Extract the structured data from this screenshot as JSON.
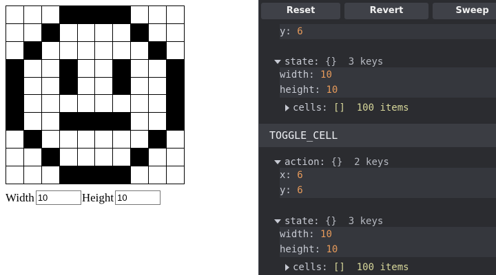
{
  "grid": {
    "cells": [
      0,
      0,
      0,
      1,
      1,
      1,
      1,
      0,
      0,
      0,
      0,
      0,
      1,
      0,
      0,
      0,
      0,
      1,
      0,
      0,
      0,
      1,
      0,
      0,
      0,
      0,
      0,
      0,
      1,
      0,
      1,
      0,
      0,
      1,
      0,
      0,
      1,
      0,
      0,
      1,
      1,
      0,
      0,
      1,
      0,
      0,
      1,
      0,
      0,
      1,
      1,
      0,
      0,
      0,
      0,
      0,
      0,
      0,
      0,
      1,
      1,
      0,
      0,
      1,
      1,
      1,
      1,
      0,
      0,
      1,
      0,
      1,
      0,
      0,
      0,
      0,
      0,
      0,
      1,
      0,
      0,
      0,
      1,
      0,
      0,
      0,
      0,
      1,
      0,
      0,
      0,
      0,
      0,
      1,
      1,
      1,
      1,
      0,
      0,
      0
    ]
  },
  "controls": {
    "width_label": "Width",
    "width_value": "10",
    "height_label": "Height",
    "height_value": "10"
  },
  "devtools": {
    "toolbar": {
      "reset": "Reset",
      "revert": "Revert",
      "sweep": "Sweep"
    },
    "log": {
      "prev_y_key": "y:",
      "prev_y_val": "6",
      "state1": {
        "key": "state:",
        "type": "{}",
        "count": "3 keys"
      },
      "state1_width_key": "width:",
      "state1_width_val": "10",
      "state1_height_key": "height:",
      "state1_height_val": "10",
      "state1_cells": {
        "key": "cells:",
        "type": "[]",
        "count": "100 items"
      },
      "action_title": "TOGGLE_CELL",
      "action": {
        "key": "action:",
        "type": "{}",
        "count": "2 keys"
      },
      "action_x_key": "x:",
      "action_x_val": "6",
      "action_y_key": "y:",
      "action_y_val": "6",
      "state2": {
        "key": "state:",
        "type": "{}",
        "count": "3 keys"
      },
      "state2_width_key": "width:",
      "state2_width_val": "10",
      "state2_height_key": "height:",
      "state2_height_val": "10",
      "state2_cells": {
        "key": "cells:",
        "type": "[]",
        "count": "100 items"
      }
    }
  }
}
